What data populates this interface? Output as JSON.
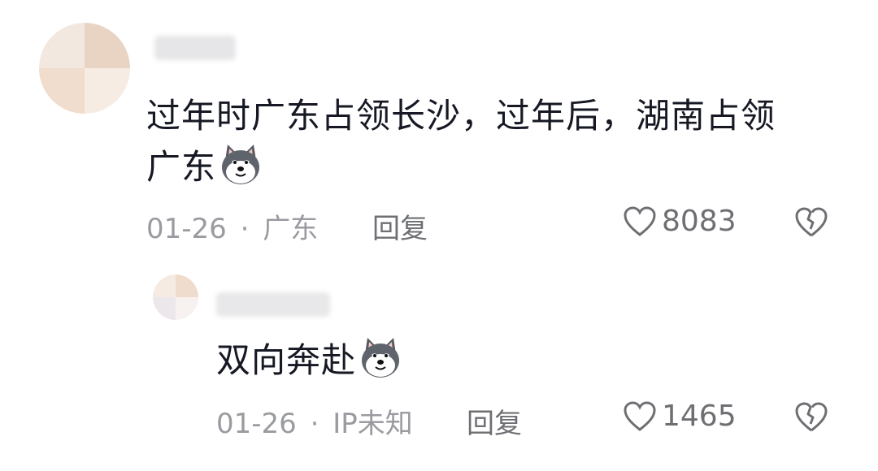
{
  "comments": [
    {
      "text": "过年时广东占领长沙，过年后，湖南占领广东",
      "text_line1": "过年时广东占领长沙，过年后，湖南占领",
      "text_line2": "广东",
      "emoji_icon": "husky-dog-emoji-icon",
      "date": "01-26",
      "separator": "·",
      "location": "广东",
      "reply_label": "回复",
      "like_count": "8083"
    },
    {
      "text": "双向奔赴",
      "emoji_icon": "husky-dog-emoji-icon",
      "date": "01-26",
      "separator": "·",
      "location": "IP未知",
      "reply_label": "回复",
      "like_count": "1465"
    }
  ],
  "colors": {
    "text": "#161823",
    "meta": "#9a9ba0",
    "action": "#6e6f73",
    "background": "#ffffff"
  }
}
